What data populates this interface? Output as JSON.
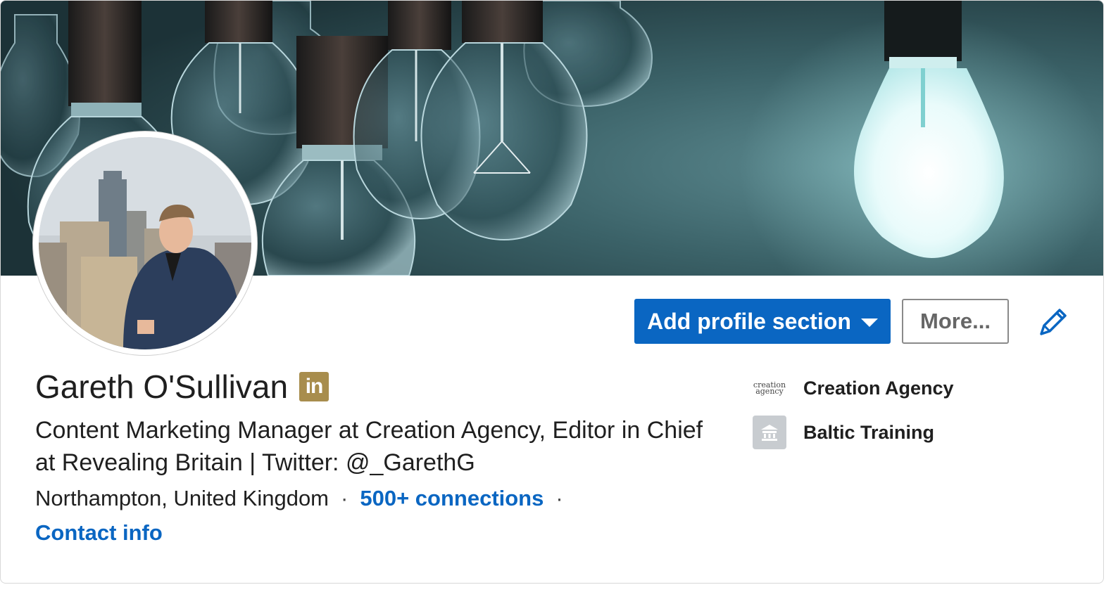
{
  "profile": {
    "name": "Gareth O'Sullivan",
    "badge_text": "in",
    "headline": "Content Marketing Manager at Creation Agency, Editor in Chief at Revealing Britain | Twitter: @_GarethG",
    "location": "Northampton, United Kingdom",
    "separator": "·",
    "connections": "500+ connections",
    "contact_info": "Contact info"
  },
  "actions": {
    "add_section_label": "Add profile section",
    "more_label": "More..."
  },
  "organizations": [
    {
      "name": "Creation Agency",
      "logo_text": "creation agency",
      "logo_icon": "creation-agency-logo"
    },
    {
      "name": "Baltic Training",
      "logo_icon": "school-icon"
    }
  ],
  "icons": {
    "edit": "pencil-icon",
    "dropdown": "caret-down-icon",
    "premium": "linkedin-badge-icon"
  },
  "colors": {
    "accent": "#0a66c2",
    "badge": "#a88d4d",
    "banner_bg": "#2f4f55"
  }
}
